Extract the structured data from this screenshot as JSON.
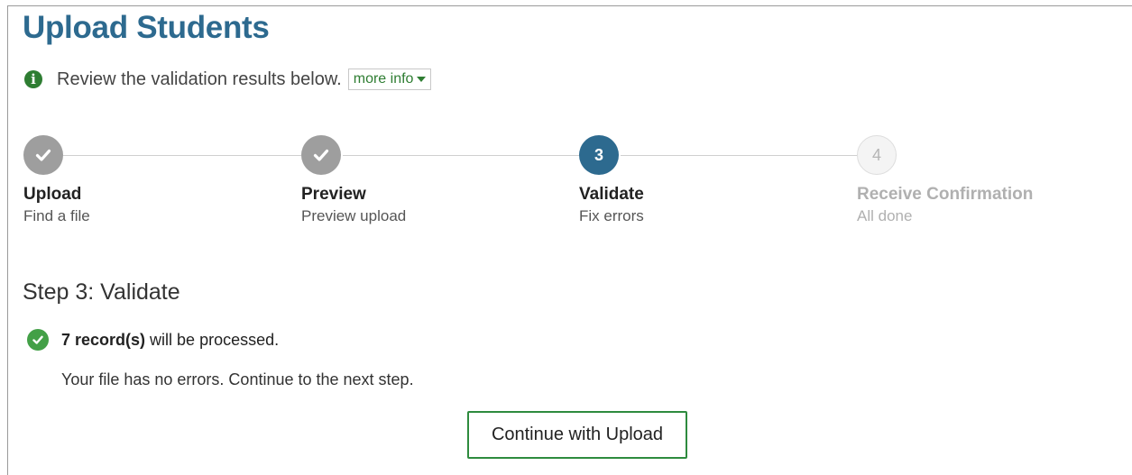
{
  "page": {
    "title": "Upload Students"
  },
  "info": {
    "text": "Review the validation results below.",
    "more_info_label": "more info",
    "icon": "info-icon"
  },
  "steps": [
    {
      "number": "1",
      "title": "Upload",
      "subtitle": "Find a file",
      "state": "done"
    },
    {
      "number": "2",
      "title": "Preview",
      "subtitle": "Preview upload",
      "state": "done"
    },
    {
      "number": "3",
      "title": "Validate",
      "subtitle": "Fix errors",
      "state": "current"
    },
    {
      "number": "4",
      "title": "Receive Confirmation",
      "subtitle": "All done",
      "state": "future"
    }
  ],
  "section": {
    "title": "Step 3: Validate",
    "result_count": "7 record(s)",
    "result_text": "will be processed.",
    "no_errors": "Your file has no errors. Continue to the next step."
  },
  "actions": {
    "continue_label": "Continue with Upload"
  },
  "colors": {
    "title": "#2d6a8f",
    "current_step": "#2d6a8f",
    "done_step": "#9e9e9e",
    "success": "#43a047",
    "accent_green": "#2e7d32"
  }
}
